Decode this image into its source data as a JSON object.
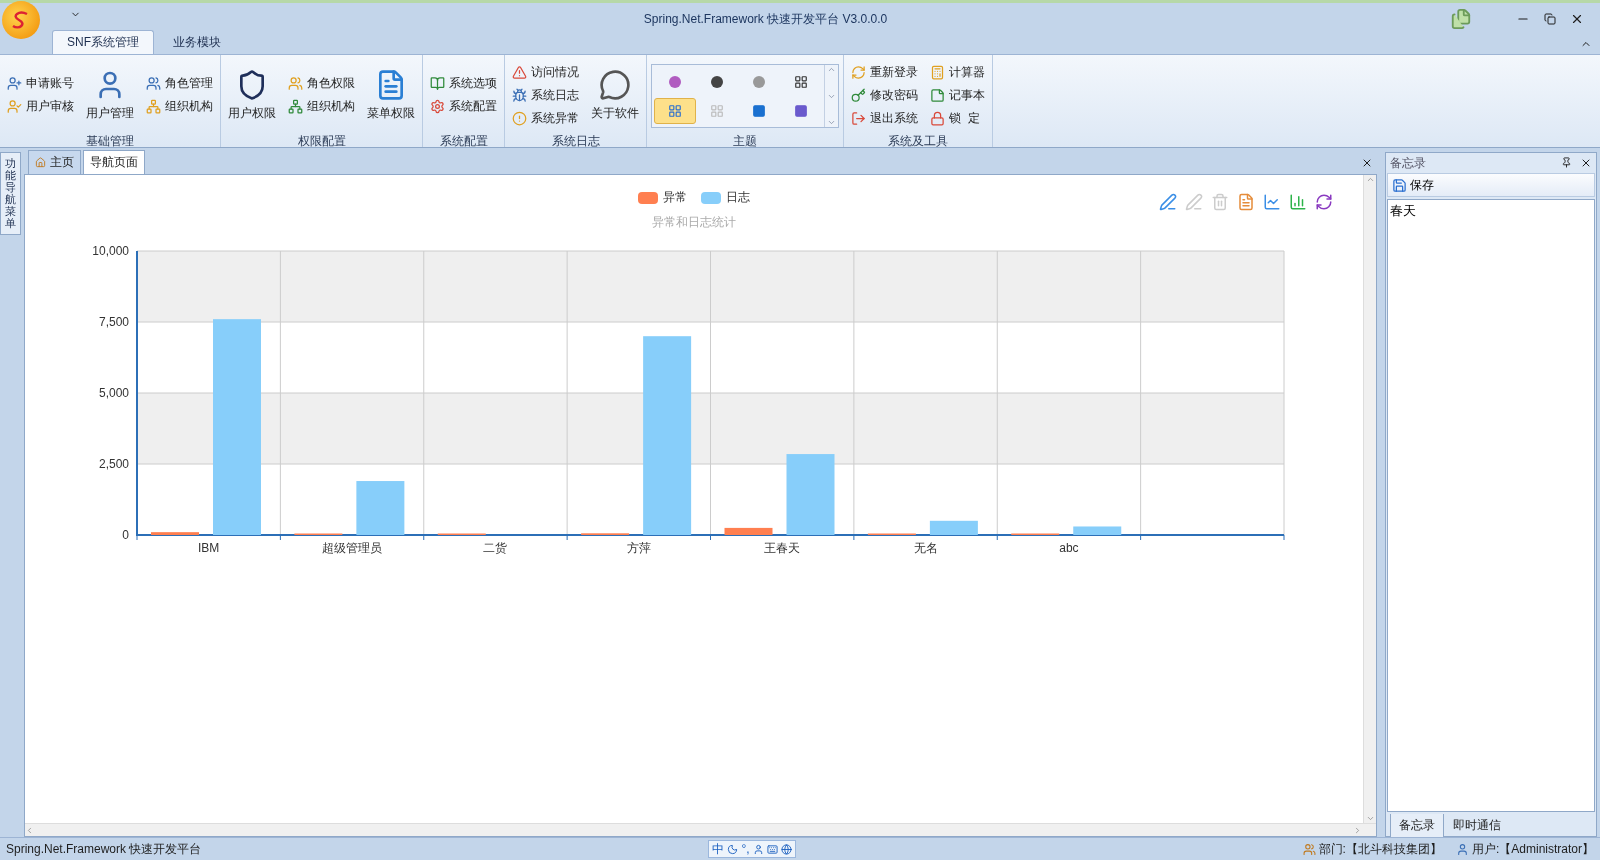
{
  "window": {
    "title": "Spring.Net.Framework 快速开发平台 V3.0.0.0"
  },
  "ribbon_tabs": [
    {
      "label": "SNF系统管理",
      "selected": true
    },
    {
      "label": "业务模块",
      "selected": false
    }
  ],
  "ribbon_groups": [
    {
      "label": "基础管理",
      "columns": [
        [
          {
            "label": "申请账号",
            "kind": "small"
          },
          {
            "label": "用户审核",
            "kind": "small"
          }
        ],
        [
          {
            "label": "用户管理",
            "kind": "large"
          }
        ],
        [
          {
            "label": "角色管理",
            "kind": "small"
          },
          {
            "label": "组织机构",
            "kind": "small"
          }
        ]
      ]
    },
    {
      "label": "权限配置",
      "columns": [
        [
          {
            "label": "用户权限",
            "kind": "large"
          }
        ],
        [
          {
            "label": "角色权限",
            "kind": "small"
          },
          {
            "label": "组织机构",
            "kind": "small"
          }
        ],
        [
          {
            "label": "菜单权限",
            "kind": "large"
          }
        ]
      ]
    },
    {
      "label": "系统配置",
      "columns": [
        [
          {
            "label": "系统选项",
            "kind": "small"
          },
          {
            "label": "系统配置",
            "kind": "small"
          }
        ]
      ]
    },
    {
      "label": "系统日志",
      "columns": [
        [
          {
            "label": "访问情况",
            "kind": "small"
          },
          {
            "label": "系统日志",
            "kind": "small"
          },
          {
            "label": "系统异常",
            "kind": "small"
          }
        ],
        [
          {
            "label": "关于软件",
            "kind": "large"
          }
        ]
      ]
    },
    {
      "label": "主题",
      "kind": "gallery",
      "themes": [
        {
          "selected": false
        },
        {
          "selected": false
        },
        {
          "selected": false
        },
        {
          "selected": false
        },
        {
          "selected": true
        },
        {
          "selected": false
        },
        {
          "selected": false
        },
        {
          "selected": false
        }
      ]
    },
    {
      "label": "系统及工具",
      "columns": [
        [
          {
            "label": "重新登录",
            "kind": "small"
          },
          {
            "label": "修改密码",
            "kind": "small"
          },
          {
            "label": "退出系统",
            "kind": "small"
          }
        ],
        [
          {
            "label": "计算器",
            "kind": "small"
          },
          {
            "label": "记事本",
            "kind": "small"
          },
          {
            "label": "锁  定",
            "kind": "small"
          }
        ]
      ]
    }
  ],
  "side_tab": {
    "label": "功能导航菜单"
  },
  "doc_tabs": [
    {
      "label": "主页",
      "selected": false
    },
    {
      "label": "导航页面",
      "selected": true
    }
  ],
  "chart": {
    "chart_data": {
      "type": "bar",
      "title": "异常和日志统计",
      "categories": [
        "IBM",
        "超级管理员",
        "二货",
        "方萍",
        "王春天",
        "无名",
        "abc"
      ],
      "grid": true,
      "ylim": [
        0,
        10000
      ],
      "yticks": [
        {
          "value": 0,
          "label": "0"
        },
        {
          "value": 2500,
          "label": "2,500"
        },
        {
          "value": 5000,
          "label": "5,000"
        },
        {
          "value": 7500,
          "label": "7,500"
        },
        {
          "value": 10000,
          "label": "10,000"
        }
      ],
      "series": [
        {
          "name": "异常",
          "color": "#ff7f50",
          "values": [
            100,
            20,
            20,
            60,
            250,
            20,
            10
          ]
        },
        {
          "name": "日志",
          "color": "#87cefa",
          "values": [
            7600,
            1900,
            0,
            7000,
            2850,
            500,
            300
          ]
        }
      ]
    }
  },
  "memo": {
    "title": "备忘录",
    "save": "保存",
    "value": "春天",
    "tabs": [
      {
        "label": "备忘录",
        "selected": true
      },
      {
        "label": "即时通信",
        "selected": false
      }
    ]
  },
  "status_bar": {
    "text": "Spring.Net.Framework 快速开发平台",
    "ime": [
      "中",
      "°,"
    ],
    "department": "部门:【北斗科技集团】",
    "user": "用户:【Administrator】"
  }
}
